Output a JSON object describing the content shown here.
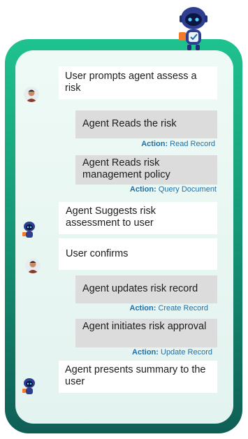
{
  "messages": [
    {
      "speaker": "user",
      "text": "User prompts agent assess a risk"
    },
    {
      "speaker": "agent-action",
      "text": "Agent Reads the risk",
      "action_label": "Action:",
      "action_value": "Read Record"
    },
    {
      "speaker": "agent-action",
      "text": "Agent Reads risk management policy",
      "action_label": "Action:",
      "action_value": "Query Document"
    },
    {
      "speaker": "agent",
      "text": "Agent Suggests risk assessment to user"
    },
    {
      "speaker": "user",
      "text": "User confirms"
    },
    {
      "speaker": "agent-action",
      "text": "Agent updates risk record",
      "action_label": "Action:",
      "action_value": "Create Record"
    },
    {
      "speaker": "agent-action",
      "text": "Agent initiates risk approval",
      "action_label": "Action:",
      "action_value": "Update Record"
    },
    {
      "speaker": "agent",
      "text": "Agent presents summary to the user"
    }
  ],
  "icons": {
    "mascot": "robot-mascot-icon",
    "user_avatar": "user-avatar-icon",
    "agent_avatar": "robot-avatar-icon"
  },
  "colors": {
    "frame_top": "#1fc28e",
    "frame_bottom": "#0f5e55",
    "panel": "#e8f6f2",
    "action_text": "#1f6fa8",
    "agent_bubble": "#dcdcdc"
  }
}
